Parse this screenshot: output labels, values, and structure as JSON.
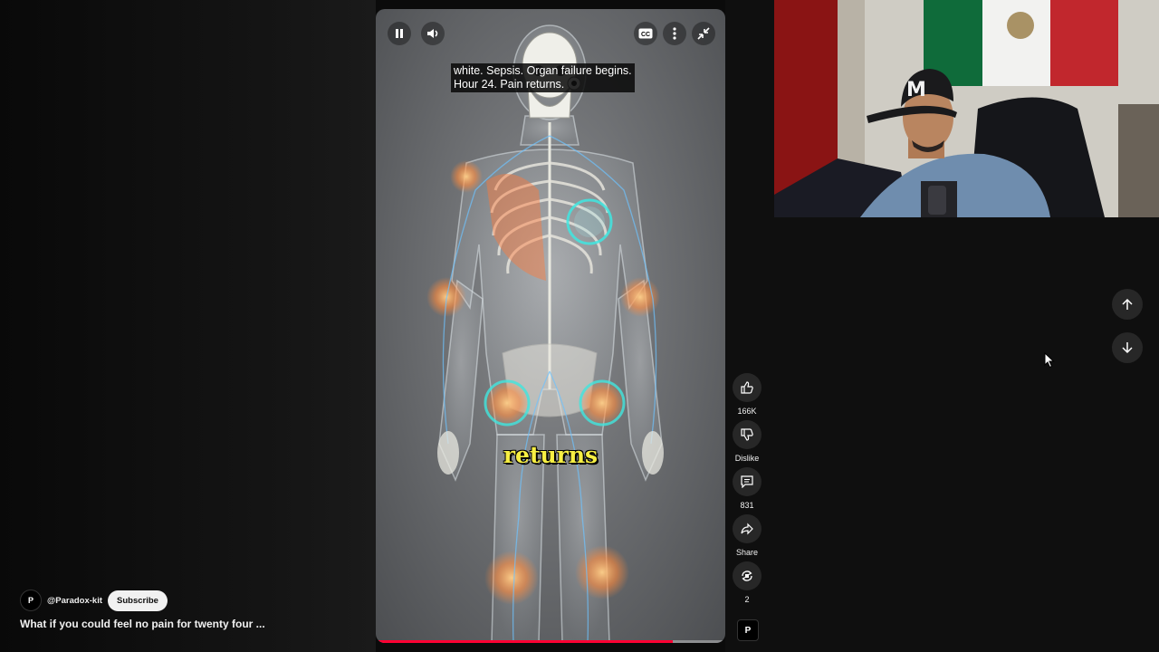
{
  "player": {
    "caption_lines": [
      "white. Sepsis. Organ failure begins.",
      "Hour 24. Pain returns."
    ],
    "overlay_word": "returns",
    "progress_fraction": 0.85,
    "icons": [
      "pause-icon",
      "volume-icon",
      "captions-icon",
      "more-icon",
      "collapse-icon"
    ]
  },
  "actions": {
    "like": {
      "icon": "thumbs-up-icon",
      "label": "166K"
    },
    "dislike": {
      "icon": "thumbs-down-icon",
      "label": "Dislike"
    },
    "comments": {
      "icon": "comment-icon",
      "label": "831"
    },
    "share": {
      "icon": "share-icon",
      "label": "Share"
    },
    "remix": {
      "icon": "remix-icon",
      "label": "2"
    }
  },
  "channel": {
    "avatar_letter": "P",
    "handle": "@Paradox-kit",
    "subscribe_label": "Subscribe"
  },
  "video": {
    "title": "What if you could feel no pain for twenty four ..."
  },
  "nav": {
    "up_icon": "arrow-up-icon",
    "down_icon": "arrow-down-icon"
  },
  "colors": {
    "accent_progress": "#ff0033",
    "overlay_text": "#f7ef43",
    "glow_teal": "#3fe6e0",
    "inflammation": "#ff8a3c"
  }
}
